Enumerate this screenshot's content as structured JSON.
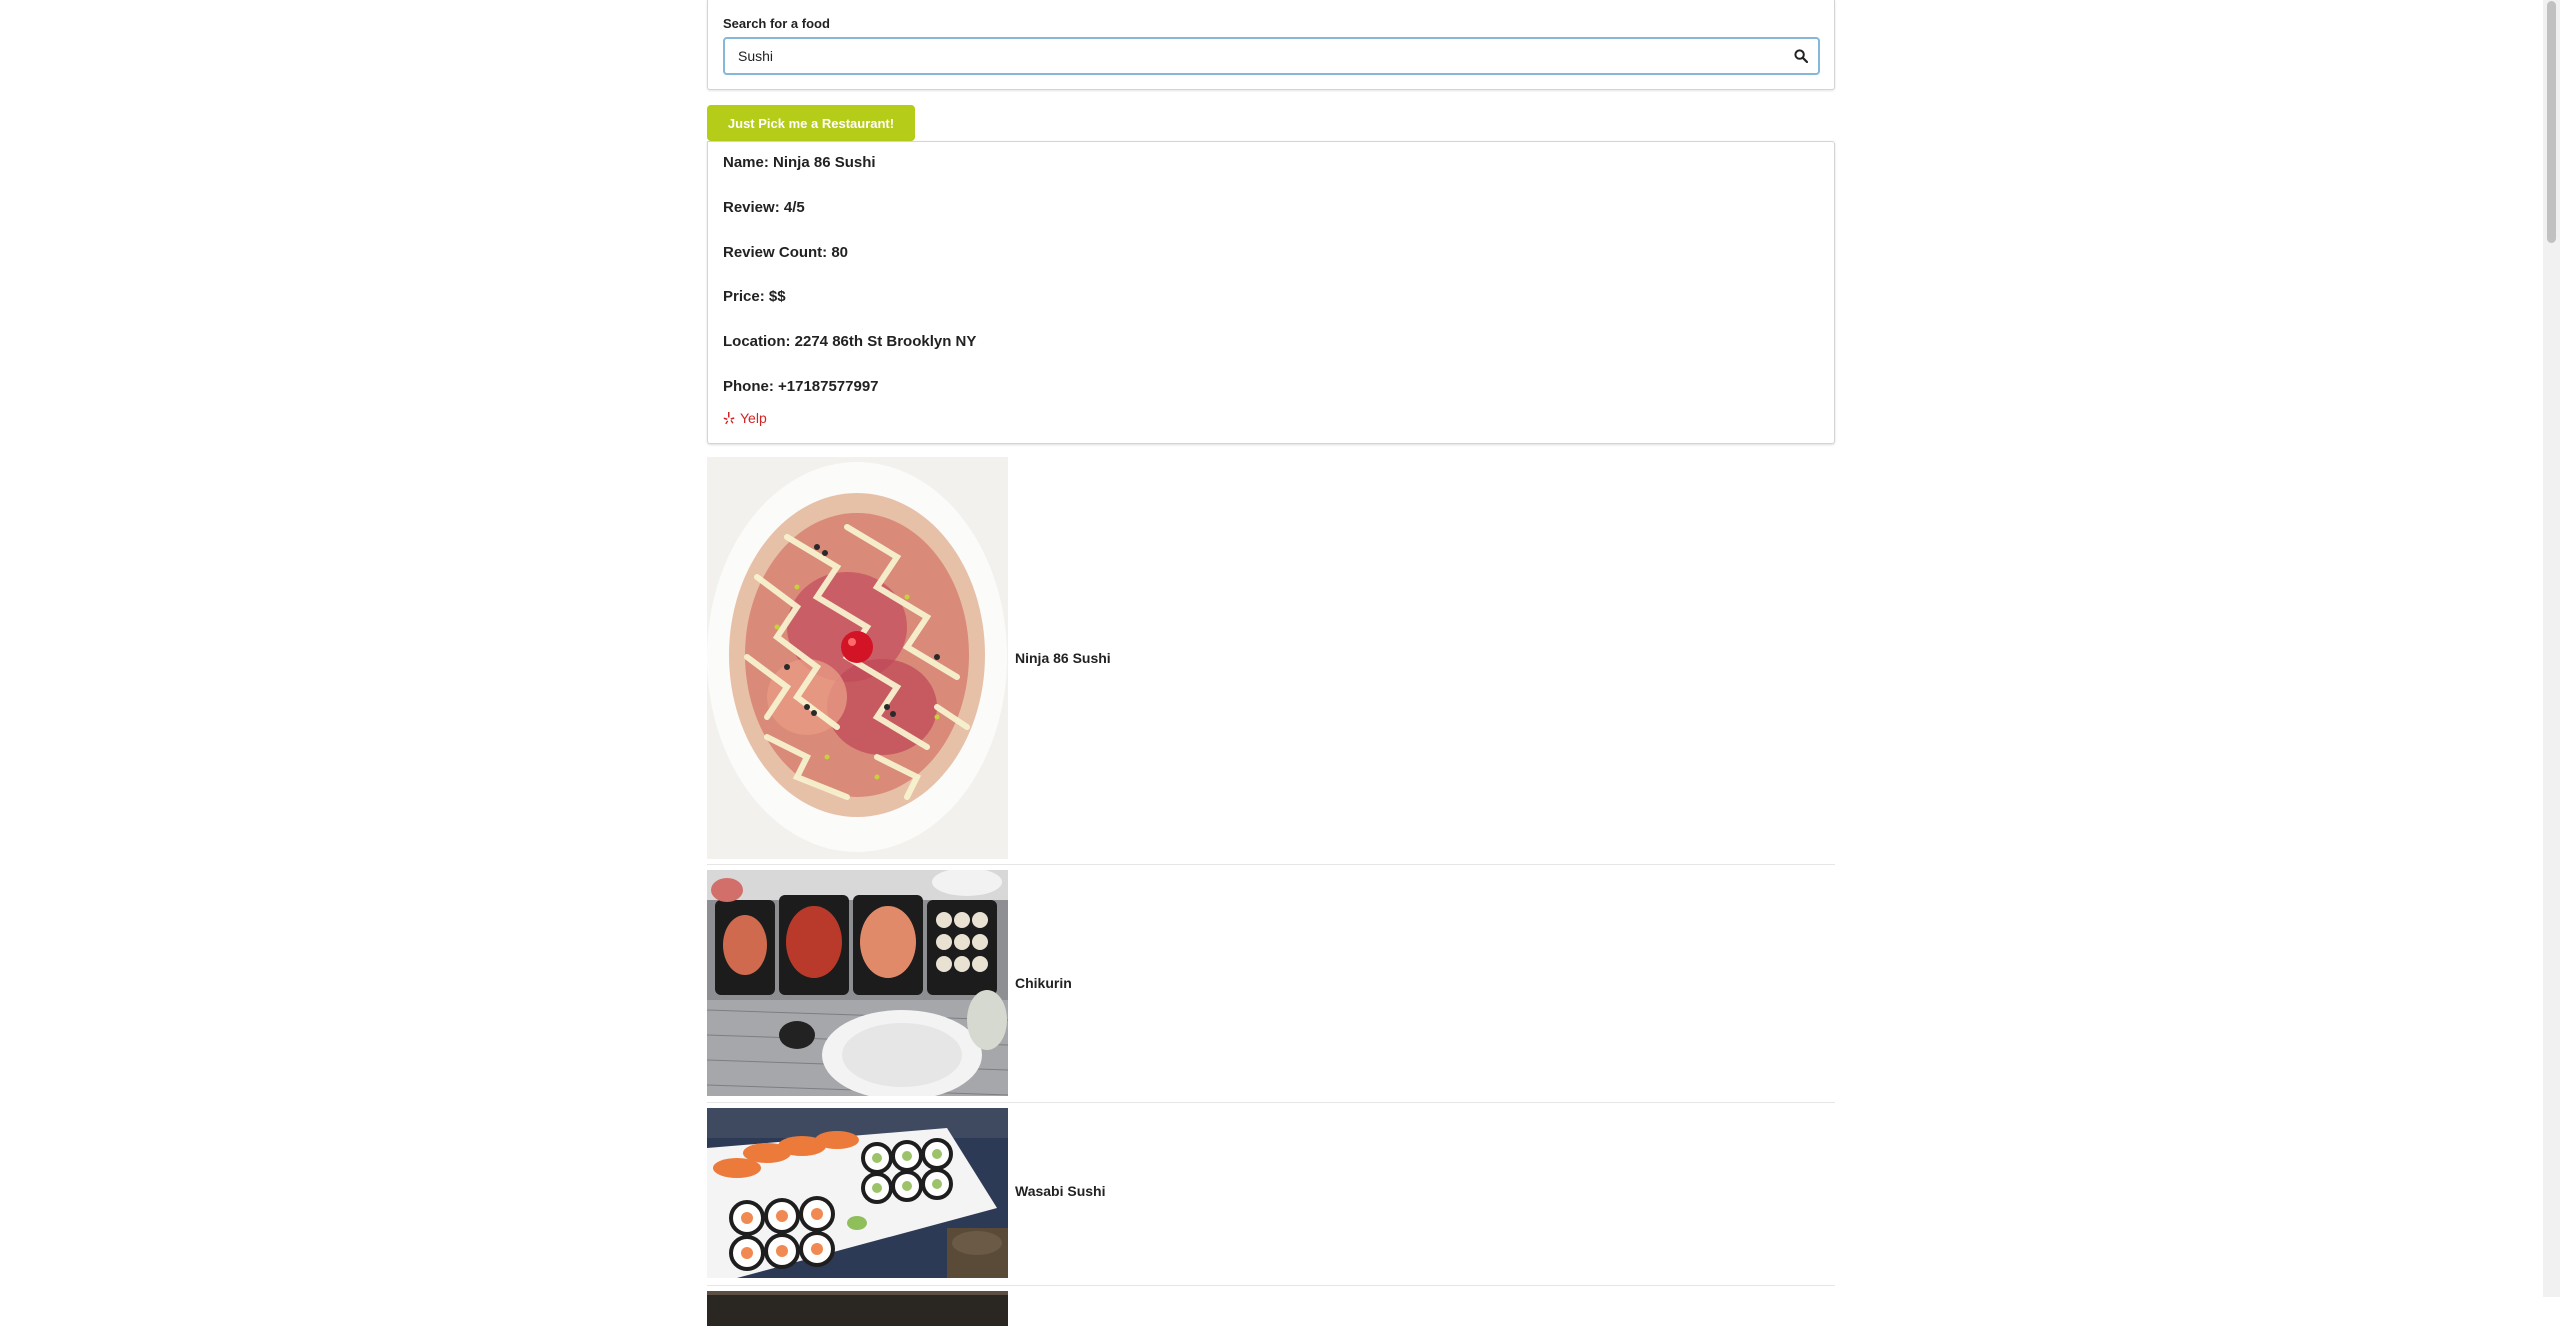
{
  "search": {
    "label": "Search for a food",
    "value": "Sushi",
    "placeholder": ""
  },
  "pick_button_label": "Just Pick me a Restaurant!",
  "selected": {
    "name_line": "Name: Ninja 86 Sushi",
    "review_line": "Review: 4/5",
    "review_count_line": "Review Count: 80",
    "price_line": "Price: $$",
    "location_line": "Location: 2274 86th St Brooklyn NY",
    "phone_line": "Phone: +17187577997",
    "yelp_label": "Yelp",
    "yelp_color": "#d32323"
  },
  "results": [
    {
      "name": "Ninja 86 Sushi",
      "photo": "food-photo-poke-plate"
    },
    {
      "name": "Chikurin",
      "photo": "food-photo-sushi-trays"
    },
    {
      "name": "Wasabi Sushi",
      "photo": "food-photo-sushi-platter"
    },
    {
      "name": "",
      "photo": "food-photo-partial"
    }
  ],
  "colors": {
    "accent_olive": "#b5cc18",
    "input_focus_border": "#85b7d9"
  }
}
